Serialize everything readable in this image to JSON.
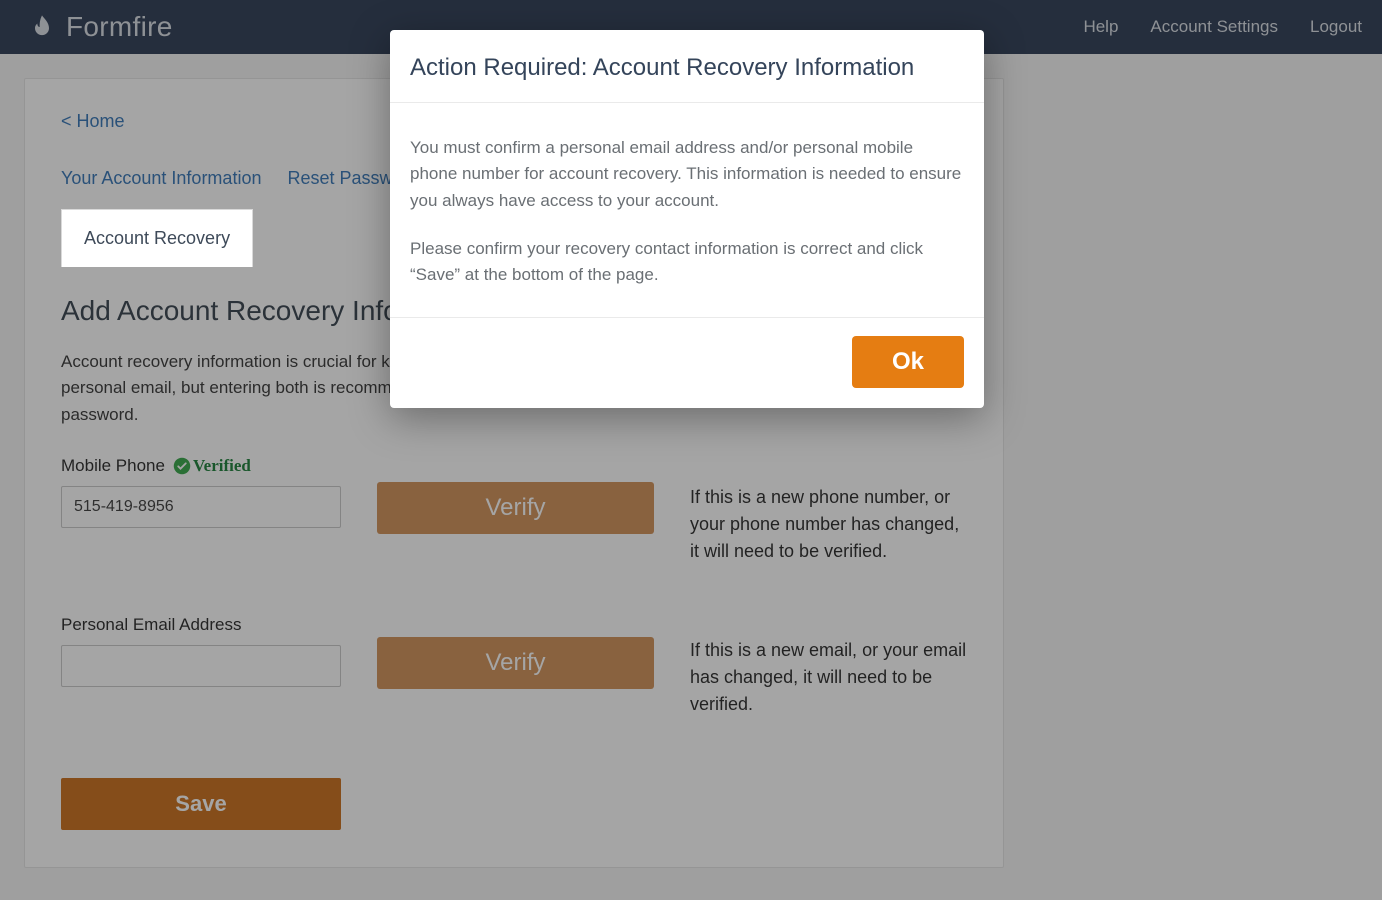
{
  "brand": "Formfire",
  "nav": {
    "help": "Help",
    "settings": "Account Settings",
    "logout": "Logout"
  },
  "breadcrumb": "< Home",
  "tabs": {
    "info": "Your Account Information",
    "reset": "Reset Password",
    "active": "Account Recovery"
  },
  "section": {
    "title": "Add Account Recovery Information",
    "desc": "Account recovery information is crucial for keeping your account safe. You must enter a personal mobile phone or a personal email, but entering both is recommended. This information will be used if you forget your username and/or password."
  },
  "phone": {
    "label": "Mobile Phone",
    "verified": "Verified",
    "value": "515-419-8956",
    "verify": "Verify",
    "help": "If this is a new phone number, or your phone number has changed, it will need to be verified."
  },
  "email": {
    "label": "Personal Email Address",
    "value": "",
    "verify": "Verify",
    "help": "If this is a new email, or your email has changed, it will need to be verified."
  },
  "save": "Save",
  "modal": {
    "title": "Action Required: Account Recovery Information",
    "p1": "You must confirm a personal email address and/or personal mobile phone number for account recovery. This information is needed to ensure you always have access to your account.",
    "p2": "Please confirm your recovery contact information is correct and click “Save” at the bottom of the page.",
    "ok": "Ok"
  }
}
